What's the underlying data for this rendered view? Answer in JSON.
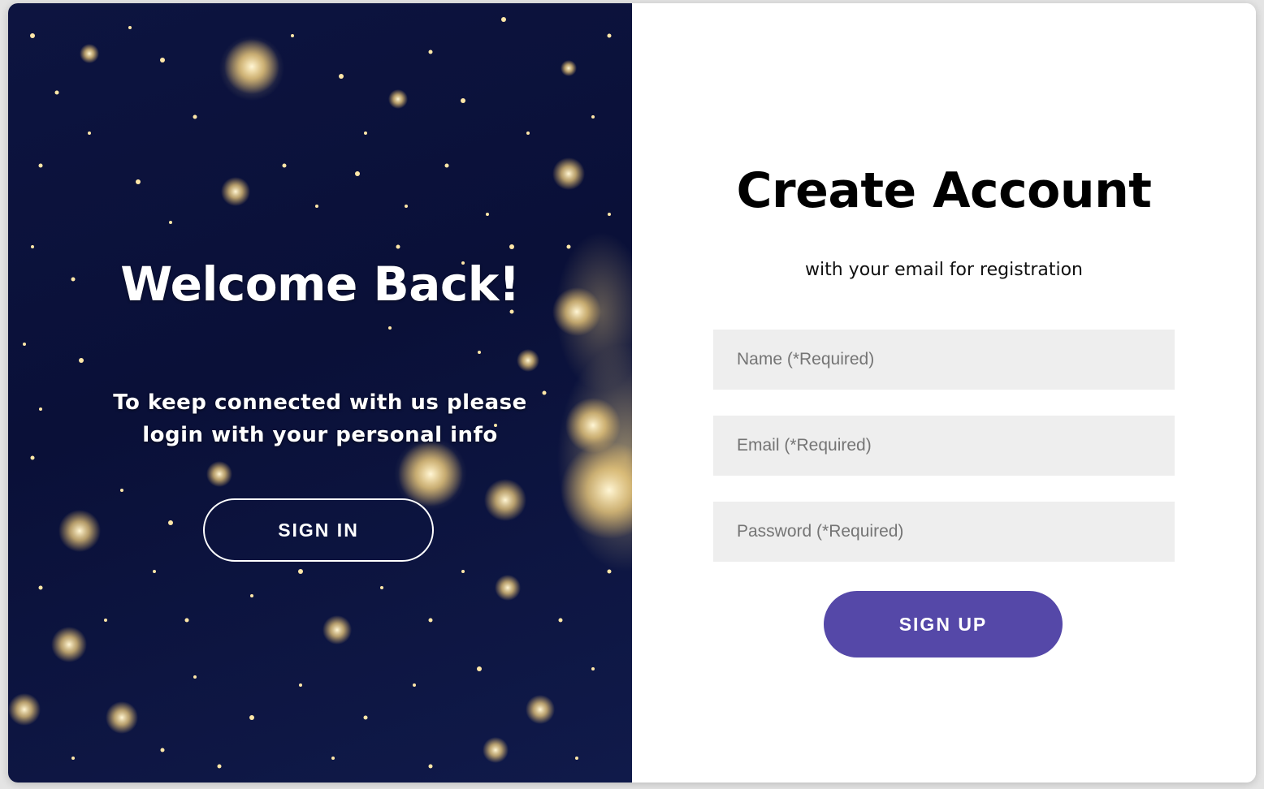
{
  "overlay": {
    "title": "Welcome Back!",
    "message": "To keep connected with us please login with your personal info",
    "signin_label": "SIGN IN"
  },
  "form": {
    "title": "Create Account",
    "subtitle": "with your email for registration",
    "name_placeholder": "Name (*Required)",
    "email_placeholder": "Email (*Required)",
    "password_placeholder": "Password (*Required)",
    "signup_label": "SIGN UP"
  },
  "colors": {
    "overlay_background": "#0d1440",
    "accent": "#5548a8",
    "input_background": "#eeeeee"
  }
}
